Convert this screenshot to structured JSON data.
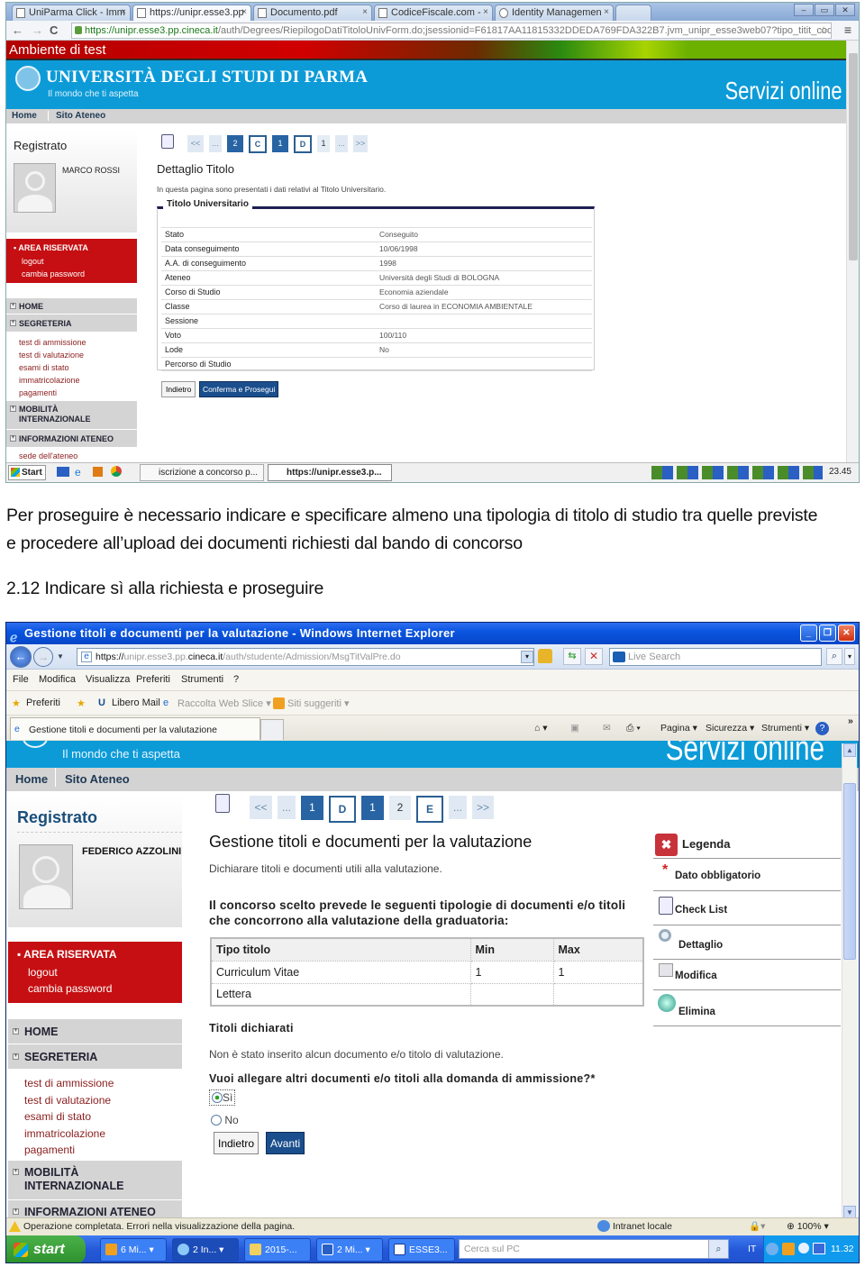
{
  "screenshot1": {
    "browser": {
      "tabs": [
        {
          "label": "UniParma Click - Imm",
          "active": false
        },
        {
          "label": "https://unipr.esse3.pp",
          "active": true
        },
        {
          "label": "Documento.pdf",
          "active": false
        },
        {
          "label": "CodiceFiscale.com -",
          "active": false
        },
        {
          "label": "Identity Managemen",
          "active": false
        }
      ],
      "url_host": "https://unipr.esse3.pp.cineca.it",
      "url_path": "/auth/Degrees/RiepilogoDatiTitoloUnivForm.do;jsessionid=F61817AA11815332DDEDA769FDA322B7.jvm_unipr_esse3web07?tipo_titit_cod=",
      "back_icon": "←",
      "forward_icon": "→",
      "reload_icon": "C",
      "menu_icon": "≡",
      "star_icon": "☆"
    },
    "env_banner": "Ambiente di test",
    "university": {
      "name": "UNIVERSITÀ DEGLI STUDI DI PARMA",
      "tagline": "Il mondo che ti aspetta",
      "services": "Servizi online"
    },
    "topnav": [
      "Home",
      "Sito Ateneo"
    ],
    "sidebar": {
      "title": "Registrato",
      "user_name": "MARCO ROSSI",
      "area_riservata": {
        "title": "AREA RISERVATA",
        "links": [
          "logout",
          "cambia password"
        ]
      },
      "sections": [
        {
          "title": "HOME",
          "links": []
        },
        {
          "title": "SEGRETERIA",
          "links": [
            "test di ammissione",
            "test di valutazione",
            "esami di stato",
            "immatricolazione",
            "pagamenti"
          ]
        },
        {
          "title": "MOBILITÀ INTERNAZIONALE",
          "links": []
        },
        {
          "title": "INFORMAZIONI ATENEO",
          "links": [
            "sede dell'ateneo"
          ]
        }
      ]
    },
    "pager": [
      "<<",
      "...",
      "2",
      "C",
      "1",
      "D",
      "1",
      "...",
      ">>"
    ],
    "main": {
      "title": "Dettaglio Titolo",
      "intro": "In questa pagina sono presentati i dati relativi al Titolo Universitario.",
      "fieldset_title": "Titolo Universitario",
      "rows": [
        {
          "label": "Stato",
          "value": "Conseguito"
        },
        {
          "label": "Data conseguimento",
          "value": "10/06/1998"
        },
        {
          "label": "A.A. di conseguimento",
          "value": "1998"
        },
        {
          "label": "Ateneo",
          "value": "Università degli Studi di BOLOGNA"
        },
        {
          "label": "Corso di Studio",
          "value": "Economia aziendale"
        },
        {
          "label": "Classe",
          "value": "Corso di laurea in ECONOMIA AMBIENTALE"
        },
        {
          "label": "Sessione",
          "value": ""
        },
        {
          "label": "Voto",
          "value": "100/110"
        },
        {
          "label": "Lode",
          "value": "No"
        },
        {
          "label": "Percorso di Studio",
          "value": ""
        }
      ],
      "back_button": "Indietro",
      "confirm_button": "Conferma e Prosegui"
    },
    "taskbar": {
      "start": "Start",
      "windows": [
        "iscrizione a concorso p...",
        "https://unipr.esse3.p..."
      ],
      "clock": "23.45"
    }
  },
  "document_text": {
    "paragraph_line1": "Per proseguire è necessario indicare e specificare almeno una tipologia di titolo di studio tra quelle previste",
    "paragraph_line2": "e procedere all’upload dei documenti richiesti dal bando di concorso",
    "step_heading": "2.12 Indicare sì alla richiesta e proseguire"
  },
  "screenshot2": {
    "window_title": "Gestione titoli e documenti per la valutazione - Windows Internet Explorer",
    "url_scheme": "https://",
    "url_pre": "unipr.esse3.pp.",
    "url_host": "cineca.it",
    "url_path": "/auth/studente/Admission/MsgTitValPre.do",
    "search_placeholder": "Live Search",
    "menu": [
      "File",
      "Modifica",
      "Visualizza",
      "Preferiti",
      "Strumenti",
      "?"
    ],
    "favorites_bar": {
      "favorites": "Preferiti",
      "items": [
        "Libero Mail",
        "Raccolta Web Slice ▾",
        "Siti suggeriti ▾"
      ]
    },
    "tab_label": "Gestione titoli e documenti per la valutazione",
    "command_bar": [
      "Pagina ▾",
      "Sicurezza ▾",
      "Strumenti ▾"
    ],
    "university": {
      "tagline": "Il mondo che ti aspetta",
      "services": "Servizi online"
    },
    "topnav": [
      "Home",
      "Sito Ateneo"
    ],
    "sidebar": {
      "title": "Registrato",
      "user_name": "FEDERICO AZZOLINI",
      "area_riservata": {
        "title": "AREA RISERVATA",
        "links": [
          "logout",
          "cambia password"
        ]
      },
      "sections": [
        {
          "title": "HOME",
          "links": []
        },
        {
          "title": "SEGRETERIA",
          "links": [
            "test di ammissione",
            "test di valutazione",
            "esami di stato",
            "immatricolazione",
            "pagamenti"
          ]
        },
        {
          "title": "MOBILITÀ INTERNAZIONALE",
          "links": []
        },
        {
          "title": "INFORMAZIONI ATENEO",
          "links": []
        }
      ]
    },
    "pager": [
      "<<",
      "...",
      "1",
      "D",
      "1",
      "2",
      "E",
      "...",
      ">>"
    ],
    "main": {
      "title": "Gestione titoli e documenti per la valutazione",
      "intro": "Dichiarare titoli e documenti utili alla valutazione.",
      "requirement_text": "Il concorso scelto prevede le seguenti tipologie di documenti e/o titoli che concorrono alla valutazione della graduatoria:",
      "table": {
        "headers": [
          "Tipo titolo",
          "Min",
          "Max"
        ],
        "rows": [
          [
            "Curriculum Vitae",
            "1",
            "1"
          ],
          [
            "Lettera",
            "",
            ""
          ]
        ]
      },
      "declared_title": "Titoli dichiarati",
      "declared_empty": "Non è stato inserito alcun documento e/o titolo di valutazione.",
      "question": "Vuoi allegare altri documenti e/o titoli alla domanda di ammissione?*",
      "options": [
        {
          "label": "Sì",
          "selected": true
        },
        {
          "label": "No",
          "selected": false
        }
      ],
      "back_button": "Indietro",
      "next_button": "Avanti"
    },
    "legend": {
      "title": "Legenda",
      "items": [
        "Dato obbligatorio",
        "Check List",
        "Dettaglio",
        "Modifica",
        "Elimina"
      ]
    },
    "status_bar": {
      "message": "Operazione completata. Errori nella visualizzazione della pagina.",
      "zone": "Intranet locale",
      "zoom": "100%"
    },
    "taskbar": {
      "start": "start",
      "buttons": [
        "6 Mi...",
        "2 In...",
        "2015-...",
        "2 Mi...",
        "ESSE3..."
      ],
      "search_placeholder": "Cerca sul PC",
      "lang": "IT",
      "clock": "11.32"
    }
  },
  "colors": {
    "brand_blue": "#0d9bd8",
    "area_red": "#c50f12",
    "pager_dark": "#2864a4",
    "button_blue": "#1a4e8c",
    "link_red": "#8a1d1d"
  }
}
